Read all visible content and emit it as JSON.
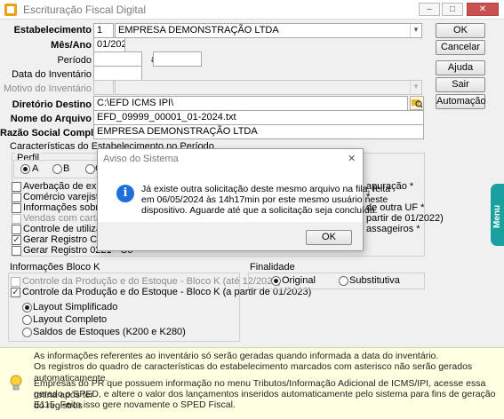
{
  "window": {
    "title": "Escrituração Fiscal Digital",
    "minimize": "–",
    "maximize": "□",
    "close": "✕"
  },
  "form": {
    "estabelecimento": {
      "label": "Estabelecimento",
      "code": "1",
      "name": "EMPRESA DEMONSTRAÇÃO LTDA"
    },
    "mes_ano": {
      "label": "Mês/Ano",
      "value": "01/2024"
    },
    "periodo": {
      "label": "Período",
      "from": "",
      "separator": "a",
      "to": ""
    },
    "data_inventario": {
      "label": "Data do Inventário",
      "value": ""
    },
    "motivo_inventario": {
      "label": "Motivo do Inventário"
    },
    "diretorio": {
      "label": "Diretório Destino",
      "value": "C:\\EFD ICMS IPI\\"
    },
    "nome_arquivo": {
      "label": "Nome do Arquivo",
      "value": "EFD_09999_00001_01-2024.txt"
    },
    "razao_social": {
      "label": "Razão Social Completa",
      "value": "EMPRESA DEMONSTRAÇÃO LTDA"
    }
  },
  "buttons": {
    "ok": "OK",
    "cancelar": "Cancelar",
    "ajuda": "Ajuda",
    "sair": "Sair",
    "automacao": "Automação"
  },
  "caracteristicas": {
    "title": "Características do Estabelecimento no Período",
    "perfil": {
      "title": "Perfil",
      "options": [
        "A",
        "B",
        "C"
      ],
      "selected": "A"
    },
    "items_left": [
      "Averbação de exportaç",
      "Comércio varejista de co",
      "Informações sobre valor",
      "Vendas com cartão de cr",
      "Controle de utilização de",
      "Gerar Registro C191 - In",
      "Gerar Registro 0221 - Co"
    ],
    "items_right": [
      "apuração *",
      "*",
      "de outra UF *",
      "partir de 01/2022)",
      "assageiros *"
    ]
  },
  "bloco_k": {
    "title": "Informações Bloco K",
    "item1": "Controle da Produção e do Estoque - Bloco K (até 12/2022)",
    "item2": "Controle da Produção e do Estoque - Bloco K (a partir de 01/2023)",
    "layouts": [
      "Layout Simplificado",
      "Layout Completo",
      "Saldos de Estoques (K200 e K280)"
    ],
    "layout_selected": "Layout Simplificado"
  },
  "finalidade": {
    "title": "Finalidade",
    "options": [
      "Original",
      "Substitutiva"
    ],
    "selected": "Original"
  },
  "info": {
    "line1": "As informações referentes ao inventário só serão geradas quando informada a data do inventário.",
    "line2": "Os registros do quadro de características do estabelecimento marcados com asterisco não serão gerados automaticamente.",
    "para_lines": [
      "Empresas do PR que possuem informação no menu Tributos/Informação Adicional de ICMS/IPI, acesse essa rotina após ter",
      "gerado o SPED, e altere o valor dos lançamentos inseridos automaticamente pelo sistema para fins de geração do registros",
      "E115. Feito isso gere novamente o SPED Fiscal."
    ]
  },
  "side_menu": {
    "label": "Menu"
  },
  "dialog": {
    "title": "Aviso do Sistema",
    "close": "✕",
    "lines": [
      "Já existe outra solicitação deste mesmo arquivo na fila, feita",
      "em 06/05/2024 às 14h17min por este mesmo usuário neste",
      "dispositivo. Aguarde até que a solicitação seja concluída."
    ],
    "ok": "OK"
  },
  "colors": {
    "menu_tab": "#19a1a0",
    "info_icon": "#1e6fd9",
    "info_background": "#ffffe1"
  }
}
